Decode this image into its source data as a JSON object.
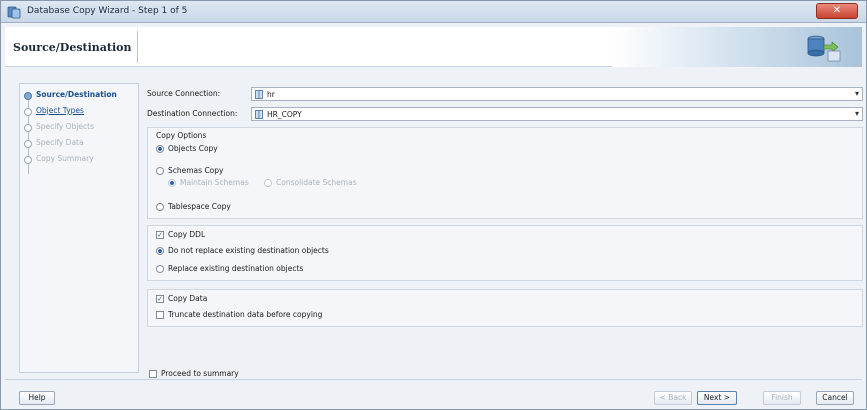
{
  "window": {
    "title": "Database Copy Wizard - Step 1 of 5",
    "close_label": "✕"
  },
  "header": {
    "title": "Source/Destination"
  },
  "nav": {
    "items": [
      {
        "label": "Source/Destination",
        "state": "active"
      },
      {
        "label": "Object Types",
        "state": "link"
      },
      {
        "label": "Specify Objects",
        "state": "disabled"
      },
      {
        "label": "Specify Data",
        "state": "disabled"
      },
      {
        "label": "Copy Summary",
        "state": "disabled"
      }
    ]
  },
  "connections": {
    "source_label": "Source Connection:",
    "source_value": "hr",
    "destination_label": "Destination Connection:",
    "destination_value": "HR_COPY"
  },
  "copy_options": {
    "title": "Copy Options",
    "objects_copy": "Objects Copy",
    "schemas_copy": "Schemas Copy",
    "maintain_schemas": "Maintain Schemas",
    "consolidate_schemas": "Consolidate Schemas",
    "tablespace_copy": "Tablespace Copy"
  },
  "ddl": {
    "copy_ddl": "Copy DDL",
    "do_not_replace": "Do not replace existing destination objects",
    "replace": "Replace existing destination objects"
  },
  "data": {
    "copy_data": "Copy Data",
    "truncate": "Truncate destination data before copying"
  },
  "proceed": {
    "label": "Proceed to summary"
  },
  "buttons": {
    "help": "Help",
    "back": "< Back",
    "next": "Next >",
    "finish": "Finish",
    "cancel": "Cancel"
  }
}
